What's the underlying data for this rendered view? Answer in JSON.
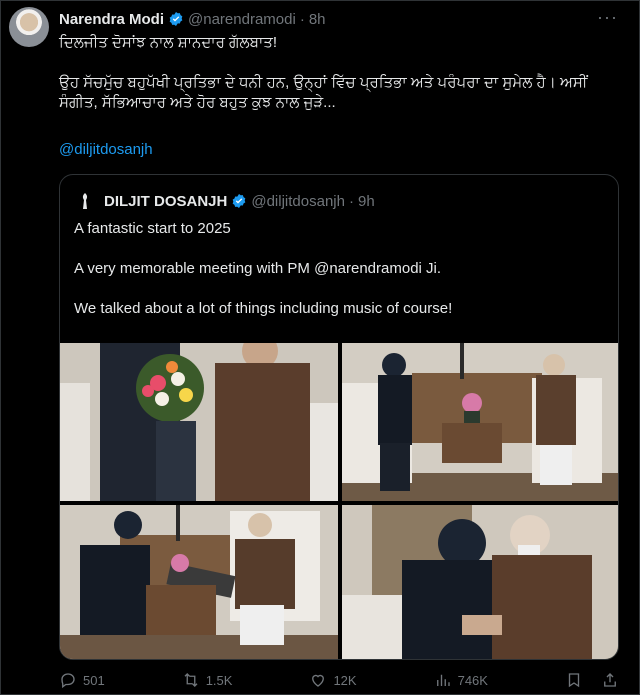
{
  "post": {
    "author_name": "Narendra Modi",
    "author_handle": "@narendramodi",
    "time": "8h",
    "line1": "ਦਿਲਜੀਤ ਦੋਸਾਂਝ ਨਾਲ ਸ਼ਾਨਦਾਰ ਗੱਲਬਾਤ!",
    "line2": "ਉਹ ਸੱਚਮੁੱਚ ਬਹੁਪੱਖੀ ਪ੍ਰਤਿਭਾ ਦੇ ਧਨੀ ਹਨ, ਉਨ੍ਹਾਂ ਵਿੱਚ ਪ੍ਰਤਿਭਾ ਅਤੇ ਪਰੰਪਰਾ ਦਾ ਸੁਮੇਲ ਹੈ। ਅਸੀਂ ਸੰਗੀਤ, ਸੱਭਿਆਚਾਰ ਅਤੇ ਹੋਰ ਬਹੁਤ ਕੁਝ ਨਾਲ ਜੁੜੇ...",
    "mention": "@diljitdosanjh"
  },
  "quote": {
    "author_name": "DILJIT DOSANJH",
    "author_handle": "@diljitdosanjh",
    "time": "9h",
    "line1": "A fantastic start to 2025",
    "line2": "A very memorable meeting with PM @narendramodi Ji.",
    "line3": "We talked about a lot of things including music of course!"
  },
  "actions": {
    "replies": "501",
    "reposts": "1.5K",
    "likes": "12K",
    "views": "746K"
  },
  "icons": [
    "avatar",
    "verified-badge-icon",
    "more-options-icon",
    "reply-icon",
    "repost-icon",
    "like-icon",
    "views-icon",
    "bookmark-icon",
    "share-icon"
  ],
  "colors": {
    "link": "#1d9bf0",
    "muted": "#71767b",
    "background": "#000000",
    "text": "#e7e9ea"
  }
}
